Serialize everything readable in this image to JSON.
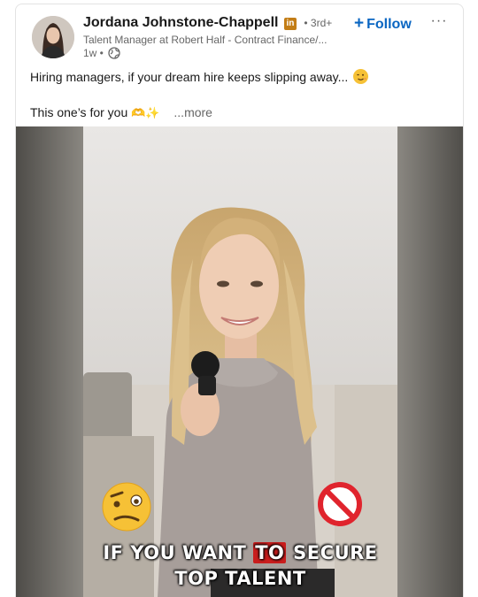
{
  "post": {
    "author_name": "Jordana Johnstone-Chappell",
    "badge": "in",
    "degree": "• 3rd+",
    "headline": "Talent Manager at Robert Half - Contract Finance/...",
    "time": "1w •",
    "follow_label": "Follow",
    "follow_icon": "plus",
    "more_label": "···",
    "text_line1": "Hiring managers, if your dream hire keeps slipping away...",
    "text_line2": "This one’s for you",
    "emoji_line2": "🫶✨",
    "see_more": "...more"
  },
  "video": {
    "caption_line1_a": "IF YOU WANT ",
    "caption_line1_highlight": "TO",
    "caption_line1_b": " SECURE",
    "caption_line2": "TOP TALENT",
    "icons": [
      "confused-face-icon",
      "prohibited-icon"
    ]
  },
  "colors": {
    "accent": "#0a66c2",
    "badge": "#c37d16",
    "highlight": "#c91d1d"
  }
}
